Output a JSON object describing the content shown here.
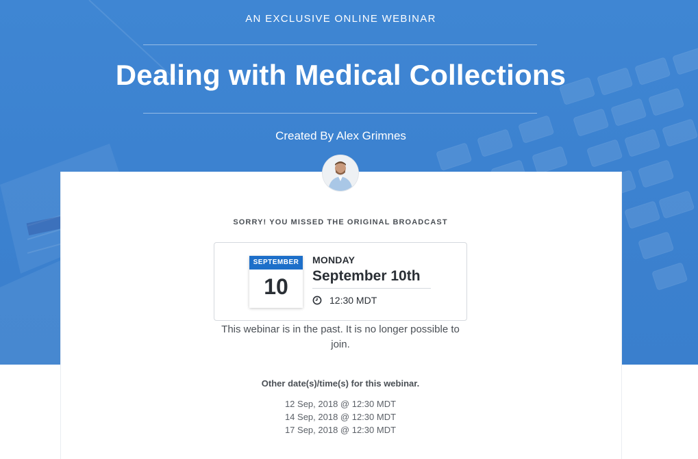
{
  "hero": {
    "eyebrow": "AN EXCLUSIVE ONLINE WEBINAR",
    "title": "Dealing with Medical Collections",
    "creator": "Created By Alex Grimnes"
  },
  "broadcast": {
    "notice": "SORRY! YOU MISSED THE ORIGINAL BROADCAST",
    "calendar": {
      "month": "SEPTEMBER",
      "day": "10"
    },
    "weekday": "MONDAY",
    "long_date": "September 10th",
    "time": "12:30 MDT",
    "time_icon": "clock-icon",
    "past_note": "This webinar is in the past. It is no longer possible to join."
  },
  "other_dates": {
    "heading": "Other date(s)/time(s) for this webinar.",
    "items": [
      "12 Sep, 2018 @ 12:30 MDT",
      "14 Sep, 2018 @ 12:30 MDT",
      "17 Sep, 2018 @ 12:30 MDT"
    ]
  },
  "colors": {
    "hero_blue": "#3c82d0",
    "calendar_blue": "#1d6fc9",
    "text_dark": "#2a2f35"
  }
}
